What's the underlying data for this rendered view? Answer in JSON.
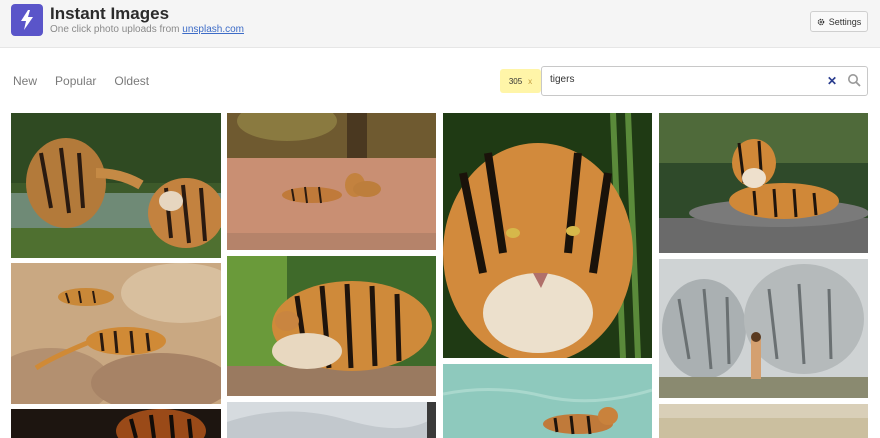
{
  "header": {
    "app_title": "Instant Images",
    "subtitle_prefix": "One click photo uploads from ",
    "subtitle_link": "unsplash.com",
    "settings_label": "Settings",
    "logo_icon": "lightning-bolt-icon",
    "brand_color": "#5a55c9"
  },
  "sort": {
    "tabs": [
      "New",
      "Popular",
      "Oldest"
    ]
  },
  "search": {
    "results_count": "305",
    "results_close": "x",
    "value": "tigers",
    "clear_icon": "close-icon",
    "search_icon": "search-icon"
  },
  "photos": [
    {
      "description": "two tigers playing in water"
    },
    {
      "description": "tigers lying on dirt road"
    },
    {
      "description": "tiger face close-up"
    },
    {
      "description": "tiger lying on rock"
    },
    {
      "description": "tigers resting on rocks"
    },
    {
      "description": "tiger lying down"
    },
    {
      "description": "tiger mural with woman"
    },
    {
      "description": "dark tiger close-up"
    },
    {
      "description": "white object"
    },
    {
      "description": "tiger swimming"
    },
    {
      "description": "grass field"
    }
  ]
}
